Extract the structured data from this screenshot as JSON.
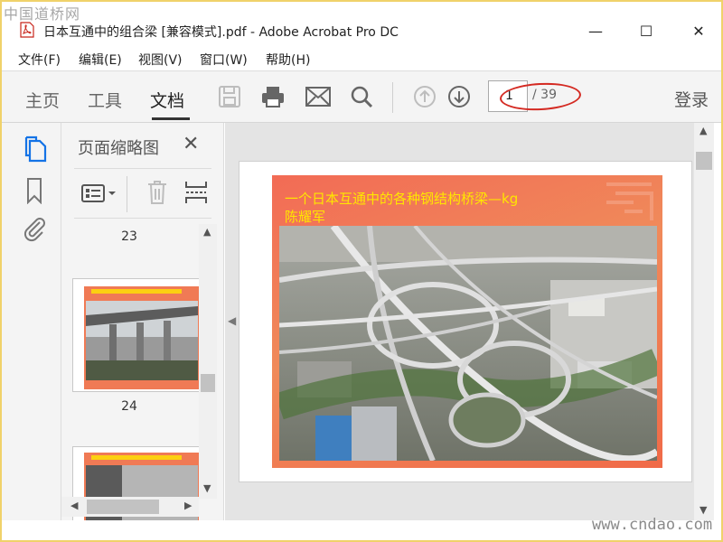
{
  "watermark": {
    "top": "中国道桥网",
    "bottom": "www.cndao.com"
  },
  "window": {
    "title": "日本互通中的组合梁 [兼容模式].pdf - Adobe Acrobat Pro DC",
    "minimize": "—",
    "maximize": "☐",
    "close": "✕"
  },
  "menu": [
    "文件(F)",
    "编辑(E)",
    "视图(V)",
    "窗口(W)",
    "帮助(H)"
  ],
  "tabs": [
    {
      "label": "主页",
      "active": false
    },
    {
      "label": "工具",
      "active": false
    },
    {
      "label": "文档",
      "active": true
    }
  ],
  "toolbar_icons": [
    "save-icon",
    "print-icon",
    "email-icon",
    "search-icon",
    "page-up-icon",
    "page-down-icon"
  ],
  "page_nav": {
    "current": "1",
    "total": "/ 39"
  },
  "login": "登录",
  "panel": {
    "title": "页面缩略图",
    "thumbnails": [
      {
        "number": "23"
      },
      {
        "number": "24"
      }
    ]
  },
  "slide": {
    "title_line1": "一个日本互通中的各种钢结构桥梁—kg",
    "title_line2": "陈耀军"
  },
  "colors": {
    "accent": "#d42a22",
    "slide_bg": "#f07a55",
    "slide_title": "#ffe600"
  }
}
